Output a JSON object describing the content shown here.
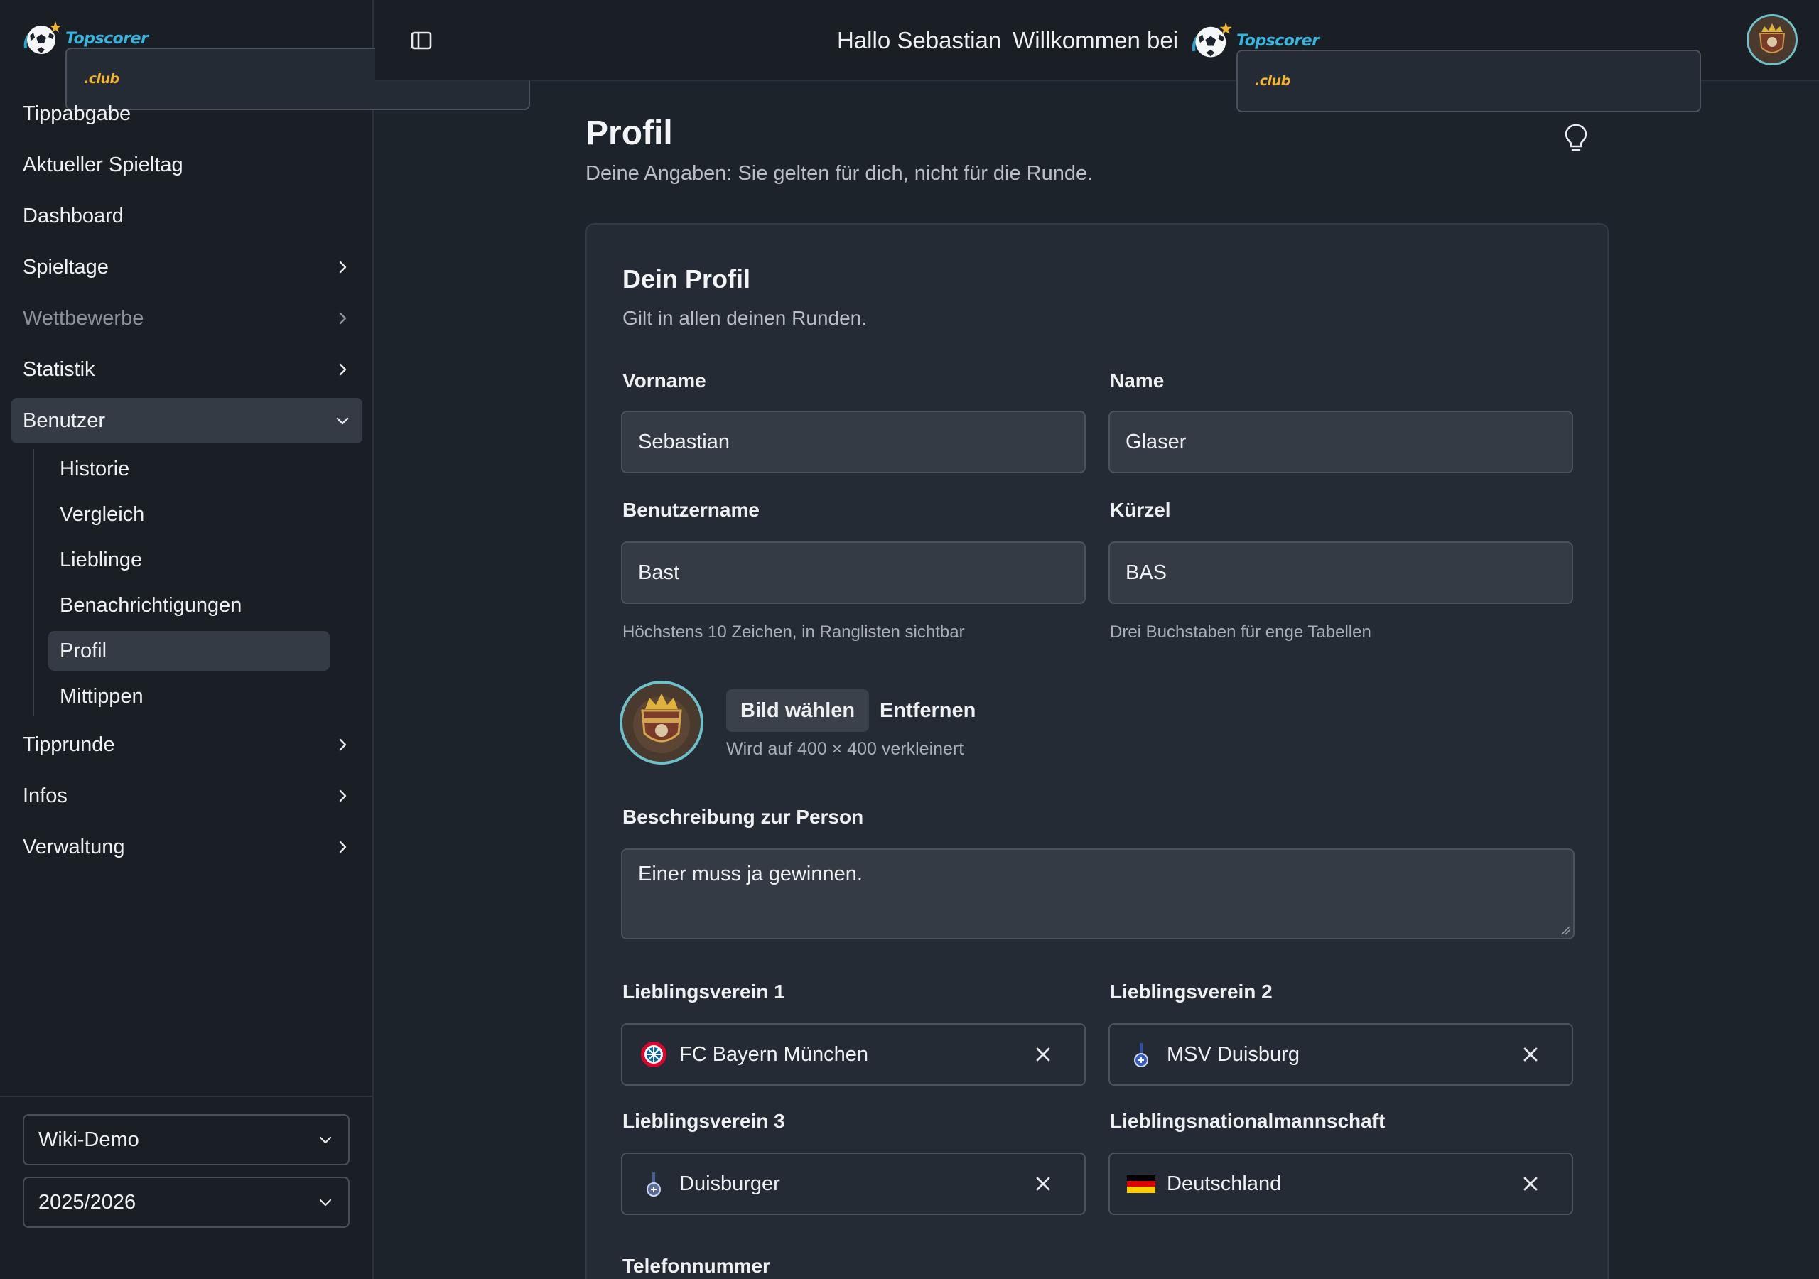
{
  "brand": {
    "name": "Topscorer",
    "tld": ".club"
  },
  "sidebar": {
    "items": [
      {
        "label": "Tippabgabe"
      },
      {
        "label": "Aktueller Spieltag"
      },
      {
        "label": "Dashboard"
      },
      {
        "label": "Spieltage"
      },
      {
        "label": "Wettbewerbe"
      },
      {
        "label": "Statistik"
      },
      {
        "label": "Benutzer"
      },
      {
        "label": "Tipprunde"
      },
      {
        "label": "Infos"
      },
      {
        "label": "Verwaltung"
      }
    ],
    "benutzer_sub": [
      {
        "label": "Historie"
      },
      {
        "label": "Vergleich"
      },
      {
        "label": "Lieblinge"
      },
      {
        "label": "Benachrichtigungen"
      },
      {
        "label": "Profil"
      },
      {
        "label": "Mittippen"
      }
    ],
    "round_select": "Wiki-Demo",
    "season_select": "2025/2026"
  },
  "header": {
    "greeting": "Hallo Sebastian",
    "welcome": "Willkommen bei"
  },
  "page": {
    "title": "Profil",
    "subtitle": "Deine Angaben: Sie gelten für dich, nicht für die Runde."
  },
  "card": {
    "title": "Dein Profil",
    "subtitle": "Gilt in allen deinen Runden.",
    "vorname_label": "Vorname",
    "vorname_value": "Sebastian",
    "name_label": "Name",
    "name_value": "Glaser",
    "benutzername_label": "Benutzername",
    "benutzername_value": "Bast",
    "benutzername_help": "Höchstens 10 Zeichen, in Ranglisten sichtbar",
    "kuerzel_label": "Kürzel",
    "kuerzel_value": "BAS",
    "kuerzel_help": "Drei Buchstaben für enge Tabellen",
    "choose_image": "Bild wählen",
    "remove_image": "Entfernen",
    "image_help": "Wird auf 400 × 400 verkleinert",
    "beschreibung_label": "Beschreibung zur Person",
    "beschreibung_value": "Einer muss ja gewinnen.",
    "verein1_label": "Lieblingsverein 1",
    "verein1_value": "FC Bayern München",
    "verein2_label": "Lieblingsverein 2",
    "verein2_value": "MSV Duisburg",
    "verein3_label": "Lieblingsverein 3",
    "verein3_value": "Duisburger",
    "nation_label": "Lieblingsnationalmannschaft",
    "nation_value": "Deutschland",
    "telefon_label": "Telefonnummer"
  },
  "colors": {
    "background": "#1d232b",
    "sidebar": "#1a1f26",
    "card": "#252b34",
    "input": "#343b44",
    "accent_cyan": "#39b4dc",
    "accent_gold": "#f2b632"
  }
}
